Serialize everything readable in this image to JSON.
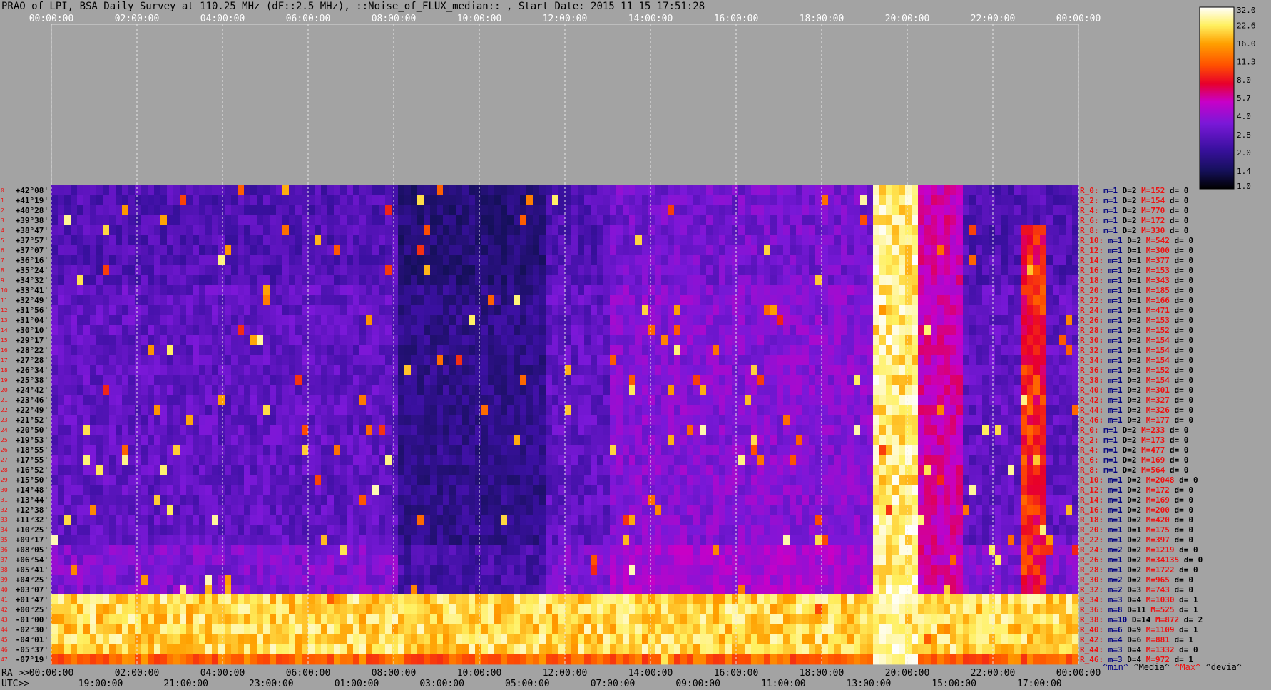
{
  "title": "PRAO of LPI, BSA Daily Survey at 110.25 MHz (dF::2.5 MHz), ::Noise_of_FLUX_median:: , Start Date: 2015 11 15 17:51:28",
  "colors": {
    "background": "#a3a3a3",
    "colormap": [
      "#000000",
      "#15105a",
      "#3a10a0",
      "#7a18d8",
      "#c800c8",
      "#e8002a",
      "#ff5000",
      "#ffa000",
      "#fff060",
      "#ffffff"
    ]
  },
  "chart_data": {
    "type": "heatmap",
    "title": "PRAO of LPI, BSA Daily Survey at 110.25 MHz (dF::2.5 MHz), ::Noise_of_FLUX_median:: , Start Date: 2015 11 15 17:51:28",
    "x_top_ticks": [
      "00:00:00",
      "02:00:00",
      "04:00:00",
      "06:00:00",
      "08:00:00",
      "10:00:00",
      "12:00:00",
      "14:00:00",
      "16:00:00",
      "18:00:00",
      "20:00:00",
      "22:00:00",
      "00:00:00"
    ],
    "x_bottom_ra_label": "RA >>",
    "x_bottom_ra_ticks": [
      "00:00:00",
      "02:00:00",
      "04:00:00",
      "06:00:00",
      "08:00:00",
      "10:00:00",
      "12:00:00",
      "14:00:00",
      "16:00:00",
      "18:00:00",
      "20:00:00",
      "22:00:00",
      "00:00:00"
    ],
    "x_bottom_utc_label": "UTC>>",
    "x_bottom_utc_ticks": [
      "19:00:00",
      "21:00:00",
      "23:00:00",
      "01:00:00",
      "03:00:00",
      "05:00:00",
      "07:00:00",
      "09:00:00",
      "11:00:00",
      "13:00:00",
      "15:00:00",
      "17:00:00"
    ],
    "declinations": [
      "+42°08'",
      "+41°19'",
      "+40°28'",
      "+39°38'",
      "+38°47'",
      "+37°57'",
      "+37°07'",
      "+36°16'",
      "+35°24'",
      "+34°32'",
      "+33°41'",
      "+32°49'",
      "+31°56'",
      "+31°04'",
      "+30°10'",
      "+29°17'",
      "+28°22'",
      "+27°28'",
      "+26°34'",
      "+25°38'",
      "+24°42'",
      "+23°46'",
      "+22°49'",
      "+21°52'",
      "+20°50'",
      "+19°53'",
      "+18°55'",
      "+17°55'",
      "+16°52'",
      "+15°50'",
      "+14°48'",
      "+13°44'",
      "+12°38'",
      "+11°32'",
      "+10°25'",
      "+09°17'",
      "+08°05'",
      "+06°54'",
      "+05°41'",
      "+04°25'",
      "+03°07'",
      "+01°47'",
      "+00°25'",
      "-01°00'",
      "-02°30'",
      "-04°01'",
      "-05°37'",
      "-07°19'"
    ],
    "row_stats": [
      {
        "r": "R_0:",
        "m": "m=1",
        "d": "D=2",
        "M": "M=152",
        "dev": "d= 0"
      },
      {
        "r": "R_2:",
        "m": "m=1",
        "d": "D=2",
        "M": "M=154",
        "dev": "d= 0"
      },
      {
        "r": "R_4:",
        "m": "m=1",
        "d": "D=2",
        "M": "M=770",
        "dev": "d= 0"
      },
      {
        "r": "R_6:",
        "m": "m=1",
        "d": "D=2",
        "M": "M=172",
        "dev": "d= 0"
      },
      {
        "r": "R_8:",
        "m": "m=1",
        "d": "D=2",
        "M": "M=330",
        "dev": "d= 0"
      },
      {
        "r": "R_10:",
        "m": "m=1",
        "d": "D=2",
        "M": "M=542",
        "dev": "d= 0"
      },
      {
        "r": "R_12:",
        "m": "m=1",
        "d": "D=1",
        "M": "M=300",
        "dev": "d= 0"
      },
      {
        "r": "R_14:",
        "m": "m=1",
        "d": "D=1",
        "M": "M=377",
        "dev": "d= 0"
      },
      {
        "r": "R_16:",
        "m": "m=1",
        "d": "D=2",
        "M": "M=153",
        "dev": "d= 0"
      },
      {
        "r": "R_18:",
        "m": "m=1",
        "d": "D=1",
        "M": "M=343",
        "dev": "d= 0"
      },
      {
        "r": "R_20:",
        "m": "m=1",
        "d": "D=1",
        "M": "M=185",
        "dev": "d= 0"
      },
      {
        "r": "R_22:",
        "m": "m=1",
        "d": "D=1",
        "M": "M=166",
        "dev": "d= 0"
      },
      {
        "r": "R_24:",
        "m": "m=1",
        "d": "D=1",
        "M": "M=471",
        "dev": "d= 0"
      },
      {
        "r": "R_26:",
        "m": "m=1",
        "d": "D=2",
        "M": "M=153",
        "dev": "d= 0"
      },
      {
        "r": "R_28:",
        "m": "m=1",
        "d": "D=2",
        "M": "M=152",
        "dev": "d= 0"
      },
      {
        "r": "R_30:",
        "m": "m=1",
        "d": "D=2",
        "M": "M=154",
        "dev": "d= 0"
      },
      {
        "r": "R_32:",
        "m": "m=1",
        "d": "D=1",
        "M": "M=154",
        "dev": "d= 0"
      },
      {
        "r": "R_34:",
        "m": "m=1",
        "d": "D=2",
        "M": "M=154",
        "dev": "d= 0"
      },
      {
        "r": "R_36:",
        "m": "m=1",
        "d": "D=2",
        "M": "M=152",
        "dev": "d= 0"
      },
      {
        "r": "R_38:",
        "m": "m=1",
        "d": "D=2",
        "M": "M=154",
        "dev": "d= 0"
      },
      {
        "r": "R_40:",
        "m": "m=1",
        "d": "D=2",
        "M": "M=301",
        "dev": "d= 0"
      },
      {
        "r": "R_42:",
        "m": "m=1",
        "d": "D=2",
        "M": "M=327",
        "dev": "d= 0"
      },
      {
        "r": "R_44:",
        "m": "m=1",
        "d": "D=2",
        "M": "M=326",
        "dev": "d= 0"
      },
      {
        "r": "R_46:",
        "m": "m=1",
        "d": "D=2",
        "M": "M=177",
        "dev": "d= 0"
      },
      {
        "r": "R_0:",
        "m": "m=1",
        "d": "D=2",
        "M": "M=233",
        "dev": "d= 0"
      },
      {
        "r": "R_2:",
        "m": "m=1",
        "d": "D=2",
        "M": "M=173",
        "dev": "d= 0"
      },
      {
        "r": "R_4:",
        "m": "m=1",
        "d": "D=2",
        "M": "M=477",
        "dev": "d= 0"
      },
      {
        "r": "R_6:",
        "m": "m=1",
        "d": "D=2",
        "M": "M=169",
        "dev": "d= 0"
      },
      {
        "r": "R_8:",
        "m": "m=1",
        "d": "D=2",
        "M": "M=564",
        "dev": "d= 0"
      },
      {
        "r": "R_10:",
        "m": "m=1",
        "d": "D=2",
        "M": "M=2048",
        "dev": "d= 0"
      },
      {
        "r": "R_12:",
        "m": "m=1",
        "d": "D=2",
        "M": "M=172",
        "dev": "d= 0"
      },
      {
        "r": "R_14:",
        "m": "m=1",
        "d": "D=2",
        "M": "M=169",
        "dev": "d= 0"
      },
      {
        "r": "R_16:",
        "m": "m=1",
        "d": "D=2",
        "M": "M=200",
        "dev": "d= 0"
      },
      {
        "r": "R_18:",
        "m": "m=1",
        "d": "D=2",
        "M": "M=420",
        "dev": "d= 0"
      },
      {
        "r": "R_20:",
        "m": "m=1",
        "d": "D=1",
        "M": "M=175",
        "dev": "d= 0"
      },
      {
        "r": "R_22:",
        "m": "m=1",
        "d": "D=2",
        "M": "M=397",
        "dev": "d= 0"
      },
      {
        "r": "R_24:",
        "m": "m=2",
        "d": "D=2",
        "M": "M=1219",
        "dev": "d= 0"
      },
      {
        "r": "R_26:",
        "m": "m=1",
        "d": "D=2",
        "M": "M=34135",
        "dev": "d= 0"
      },
      {
        "r": "R_28:",
        "m": "m=1",
        "d": "D=2",
        "M": "M=1722",
        "dev": "d= 0"
      },
      {
        "r": "R_30:",
        "m": "m=2",
        "d": "D=2",
        "M": "M=965",
        "dev": "d= 0"
      },
      {
        "r": "R_32:",
        "m": "m=2",
        "d": "D=3",
        "M": "M=743",
        "dev": "d= 0"
      },
      {
        "r": "R_34:",
        "m": "m=3",
        "d": "D=4",
        "M": "M=1030",
        "dev": "d= 1"
      },
      {
        "r": "R_36:",
        "m": "m=8",
        "d": "D=11",
        "M": "M=525",
        "dev": "d= 1"
      },
      {
        "r": "R_38:",
        "m": "m=10",
        "d": "D=14",
        "M": "M=872",
        "dev": "d= 2"
      },
      {
        "r": "R_40:",
        "m": "m=6",
        "d": "D=9",
        "M": "M=1109",
        "dev": "d= 1"
      },
      {
        "r": "R_42:",
        "m": "m=4",
        "d": "D=6",
        "M": "M=881",
        "dev": "d= 1"
      },
      {
        "r": "R_44:",
        "m": "m=3",
        "d": "D=4",
        "M": "M=1332",
        "dev": "d= 0"
      },
      {
        "r": "R_46:",
        "m": "m=3",
        "d": "D=4",
        "M": "M=972",
        "dev": "d= 1"
      }
    ],
    "colorbar_ticks": [
      "32.0",
      "22.6",
      "16.0",
      "11.3",
      "8.0",
      "5.7",
      "4.0",
      "2.8",
      "2.0",
      "1.4",
      "1.0"
    ],
    "colorbar_range": [
      1.0,
      32.0
    ],
    "colorbar_scale": "log",
    "legend": [
      {
        "text": "^min^",
        "color": "#000080"
      },
      {
        "text": "^Media^",
        "color": "#000000"
      },
      {
        "text": "^Max^",
        "color": "#ee1111"
      },
      {
        "text": "^devia^",
        "color": "#000000"
      }
    ]
  }
}
